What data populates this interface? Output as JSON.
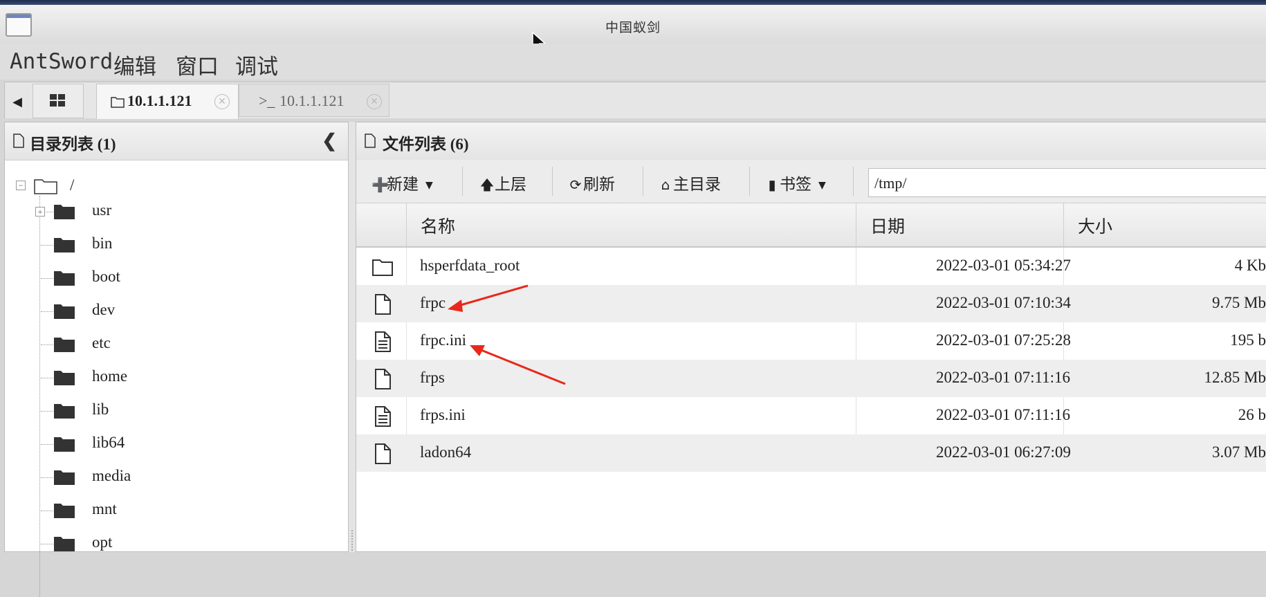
{
  "window": {
    "title": "中国蚁剑"
  },
  "menu": {
    "items": [
      "AntSword",
      "编辑",
      "窗口",
      "调试"
    ]
  },
  "tabs": [
    {
      "label": "10.1.1.121",
      "icon": "folder-icon",
      "active": true
    },
    {
      "label": "10.1.1.121",
      "icon": "terminal-icon",
      "active": false
    }
  ],
  "left_panel": {
    "title": "目录列表 (1)",
    "root": "/",
    "folders": [
      "usr",
      "bin",
      "boot",
      "dev",
      "etc",
      "home",
      "lib",
      "lib64",
      "media",
      "mnt",
      "opt"
    ]
  },
  "right_panel": {
    "title": "文件列表 (6)",
    "toolbar": {
      "new": "新建",
      "up": "上层",
      "refresh": "刷新",
      "home": "主目录",
      "bookmarks": "书签",
      "path": "/tmp/"
    },
    "columns": {
      "name": "名称",
      "date": "日期",
      "size": "大小"
    },
    "files": [
      {
        "type": "folder",
        "name": "hsperfdata_root",
        "date": "2022-03-01 05:34:27",
        "size": "4 Kb"
      },
      {
        "type": "file",
        "name": "frpc",
        "date": "2022-03-01 07:10:34",
        "size": "9.75 Mb"
      },
      {
        "type": "text-file",
        "name": "frpc.ini",
        "date": "2022-03-01 07:25:28",
        "size": "195 b"
      },
      {
        "type": "file",
        "name": "frps",
        "date": "2022-03-01 07:11:16",
        "size": "12.85 Mb"
      },
      {
        "type": "text-file",
        "name": "frps.ini",
        "date": "2022-03-01 07:11:16",
        "size": "26 b"
      },
      {
        "type": "file",
        "name": "ladon64",
        "date": "2022-03-01 06:27:09",
        "size": "3.07 Mb"
      }
    ]
  },
  "colors": {
    "annotation_arrow": "#e8281c",
    "window_accent": "#6b86c2"
  }
}
